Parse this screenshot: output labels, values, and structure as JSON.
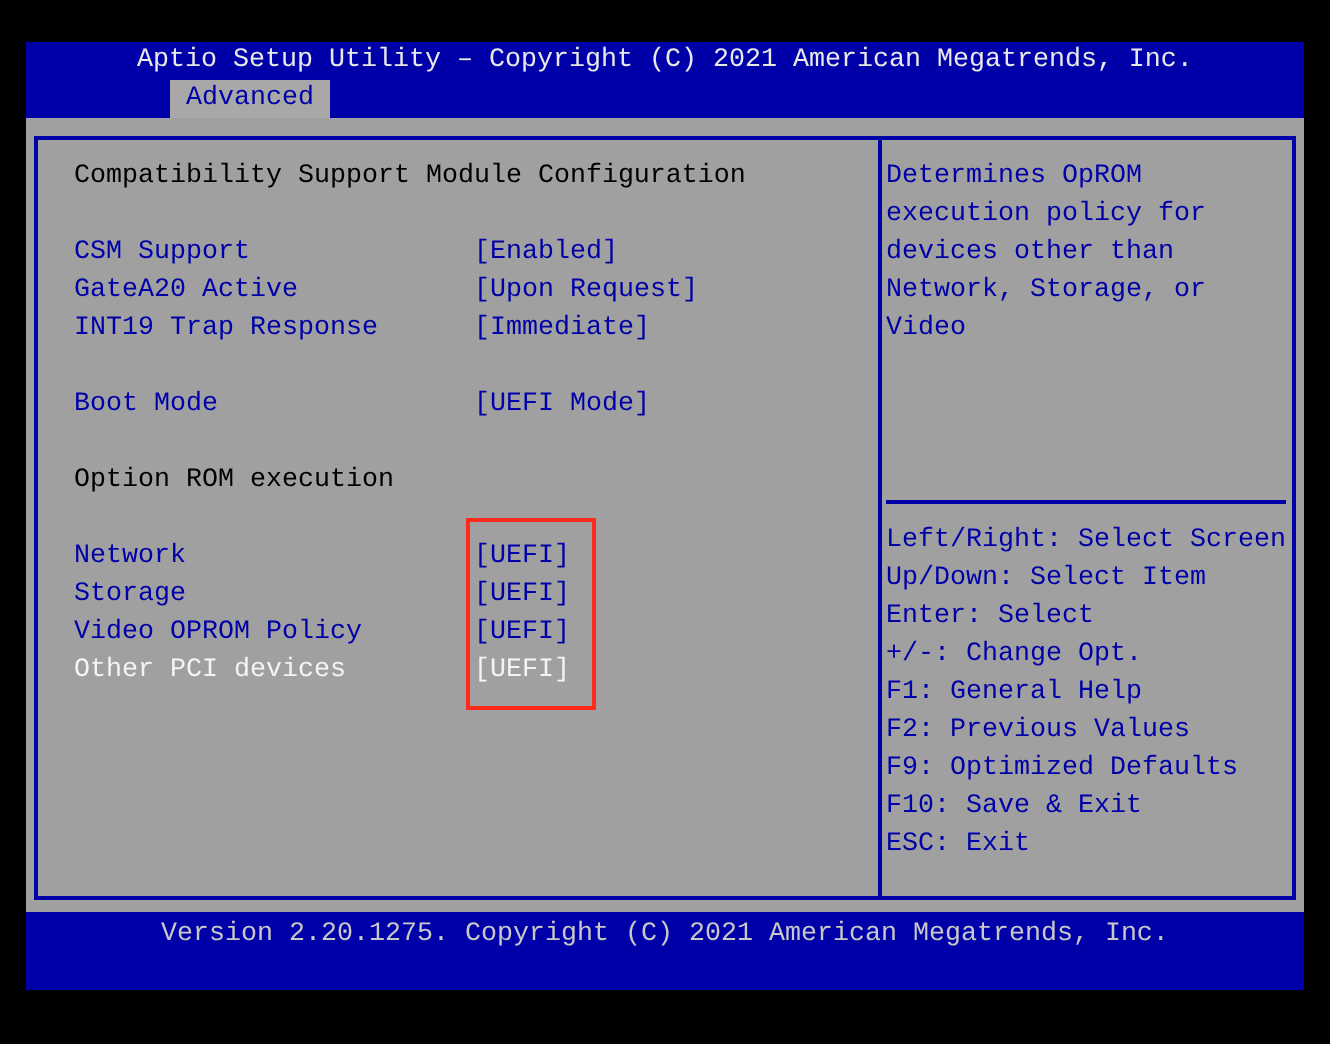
{
  "header": {
    "title": "Aptio Setup Utility – Copyright (C) 2021 American Megatrends, Inc.",
    "tabs": [
      {
        "label": "Advanced",
        "selected": true
      }
    ]
  },
  "settings_panel": {
    "sections": [
      {
        "kind": "heading",
        "text": "Compatibility Support Module Configuration"
      },
      {
        "kind": "settings",
        "items": [
          {
            "label": "CSM Support",
            "value": "[Enabled]",
            "selected": false
          },
          {
            "label": "GateA20 Active",
            "value": "[Upon Request]",
            "selected": false
          },
          {
            "label": "INT19 Trap Response",
            "value": "[Immediate]",
            "selected": false
          }
        ]
      },
      {
        "kind": "settings",
        "items": [
          {
            "label": "Boot Mode",
            "value": "[UEFI Mode]",
            "selected": false
          }
        ]
      },
      {
        "kind": "heading",
        "text": "Option ROM execution"
      },
      {
        "kind": "settings",
        "highlighted": true,
        "items": [
          {
            "label": "Network",
            "value": "[UEFI]",
            "selected": false
          },
          {
            "label": "Storage",
            "value": "[UEFI]",
            "selected": false
          },
          {
            "label": "Video OPROM Policy",
            "value": "[UEFI]",
            "selected": false
          },
          {
            "label": "Other PCI devices",
            "value": "[UEFI]",
            "selected": true
          }
        ]
      }
    ]
  },
  "help_panel": {
    "description": [
      "Determines OpROM",
      "execution policy for",
      "devices other than",
      "Network, Storage, or",
      "Video"
    ],
    "key_hints": [
      "Left/Right: Select Screen",
      "Up/Down: Select Item",
      "Enter: Select",
      "+/-: Change Opt.",
      "F1: General Help",
      "F2: Previous Values",
      "F9: Optimized Defaults",
      "F10: Save & Exit",
      "ESC: Exit"
    ]
  },
  "footer": {
    "text": "Version 2.20.1275. Copyright (C) 2021 American Megatrends, Inc."
  }
}
